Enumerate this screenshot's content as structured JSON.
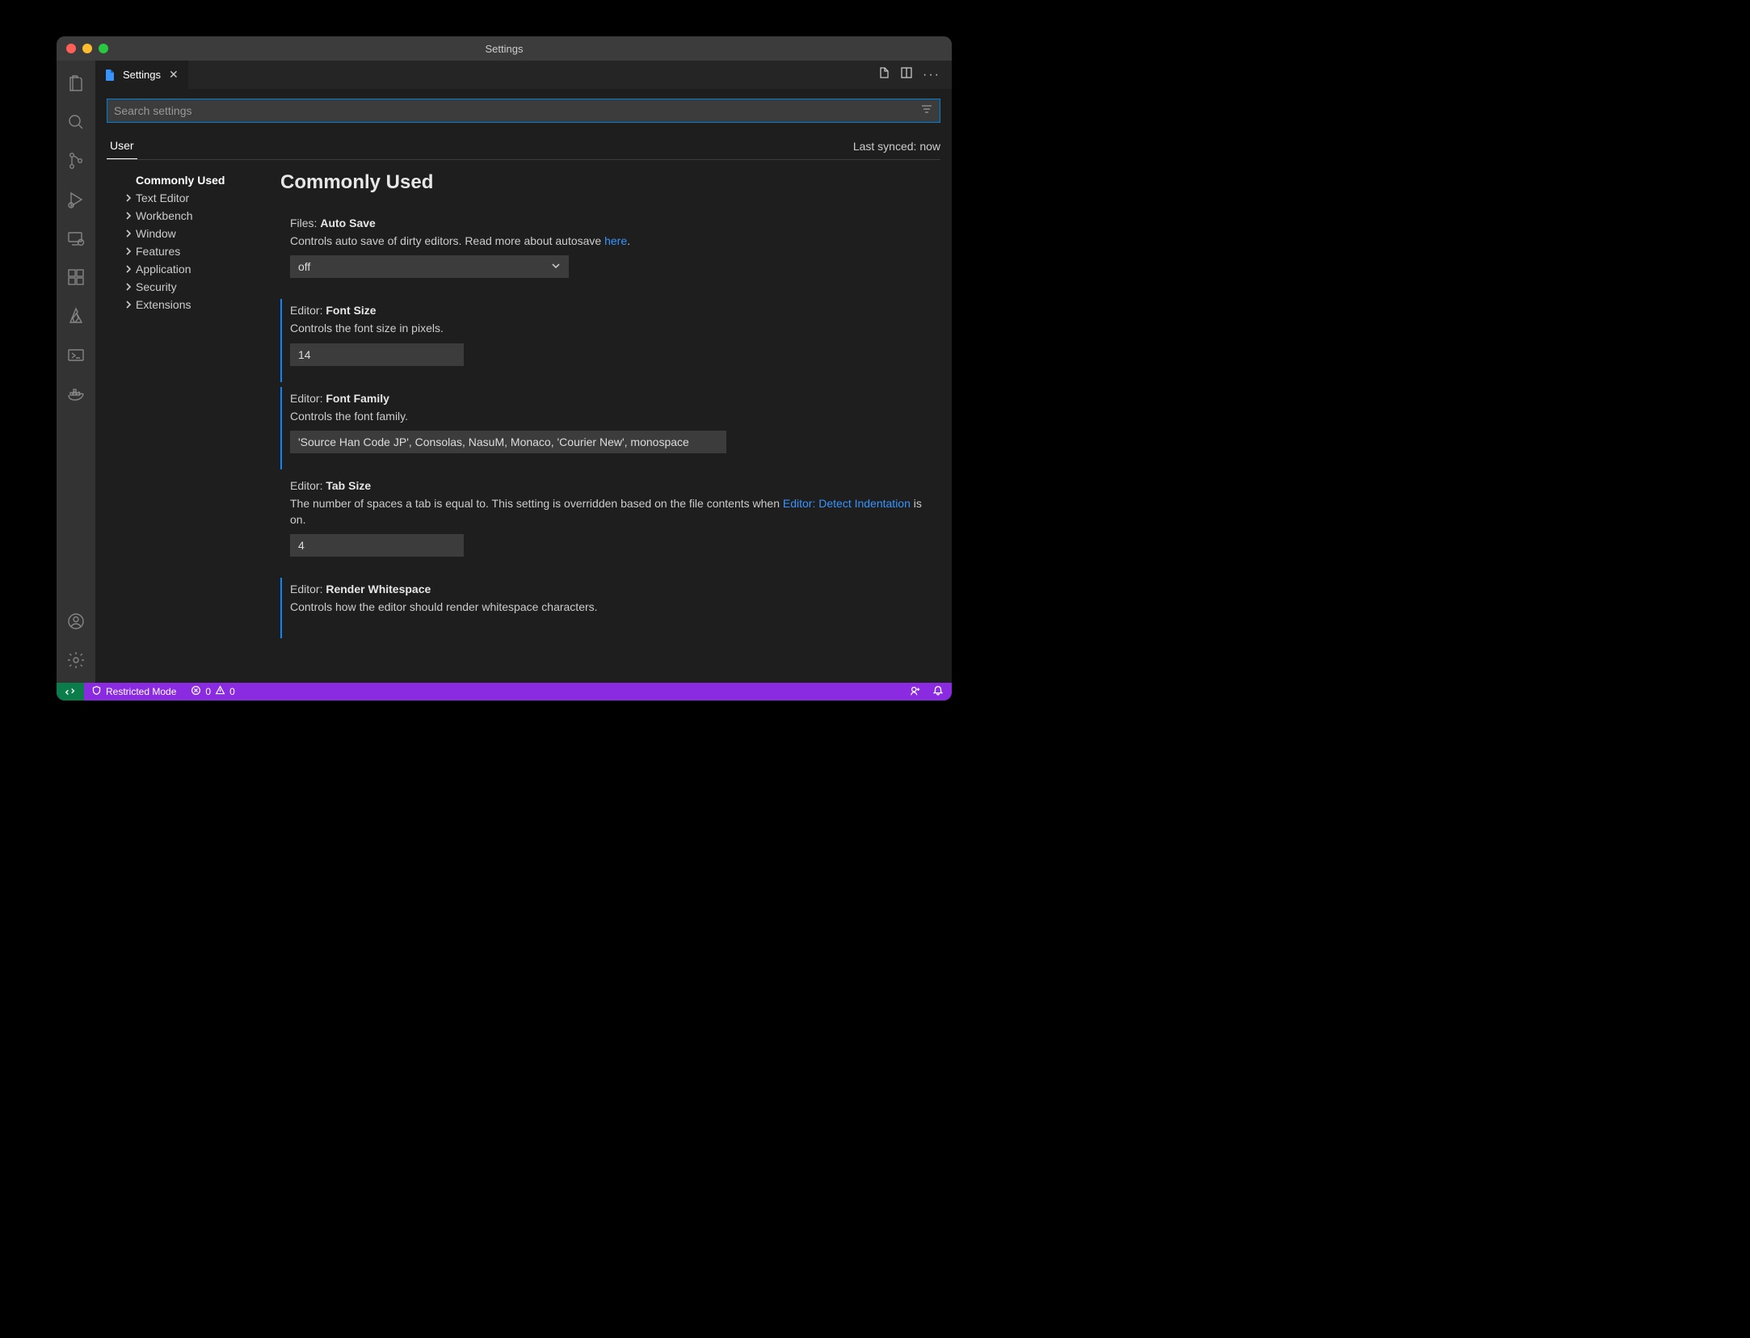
{
  "window": {
    "title": "Settings"
  },
  "tab": {
    "label": "Settings"
  },
  "search": {
    "placeholder": "Search settings"
  },
  "scope": {
    "user": "User",
    "sync": "Last synced: now"
  },
  "toc": {
    "items": [
      {
        "label": "Commonly Used",
        "expandable": false,
        "selected": true
      },
      {
        "label": "Text Editor",
        "expandable": true
      },
      {
        "label": "Workbench",
        "expandable": true
      },
      {
        "label": "Window",
        "expandable": true
      },
      {
        "label": "Features",
        "expandable": true
      },
      {
        "label": "Application",
        "expandable": true
      },
      {
        "label": "Security",
        "expandable": true
      },
      {
        "label": "Extensions",
        "expandable": true
      }
    ]
  },
  "section": {
    "heading": "Commonly Used"
  },
  "settings": {
    "autoSave": {
      "category": "Files: ",
      "name": "Auto Save",
      "desc_pre": "Controls auto save of dirty editors. Read more about autosave ",
      "desc_link": "here",
      "desc_post": ".",
      "value": "off"
    },
    "fontSize": {
      "category": "Editor: ",
      "name": "Font Size",
      "desc": "Controls the font size in pixels.",
      "value": "14"
    },
    "fontFamily": {
      "category": "Editor: ",
      "name": "Font Family",
      "desc": "Controls the font family.",
      "value": "'Source Han Code JP', Consolas, NasuM, Monaco, 'Courier New', monospace"
    },
    "tabSize": {
      "category": "Editor: ",
      "name": "Tab Size",
      "desc_pre": "The number of spaces a tab is equal to. This setting is overridden based on the file contents when ",
      "desc_link": "Editor: Detect Indentation",
      "desc_post": " is on.",
      "value": "4"
    },
    "renderWhitespace": {
      "category": "Editor: ",
      "name": "Render Whitespace",
      "desc": "Controls how the editor should render whitespace characters."
    }
  },
  "statusbar": {
    "restricted": "Restricted Mode",
    "errors": "0",
    "warnings": "0"
  }
}
